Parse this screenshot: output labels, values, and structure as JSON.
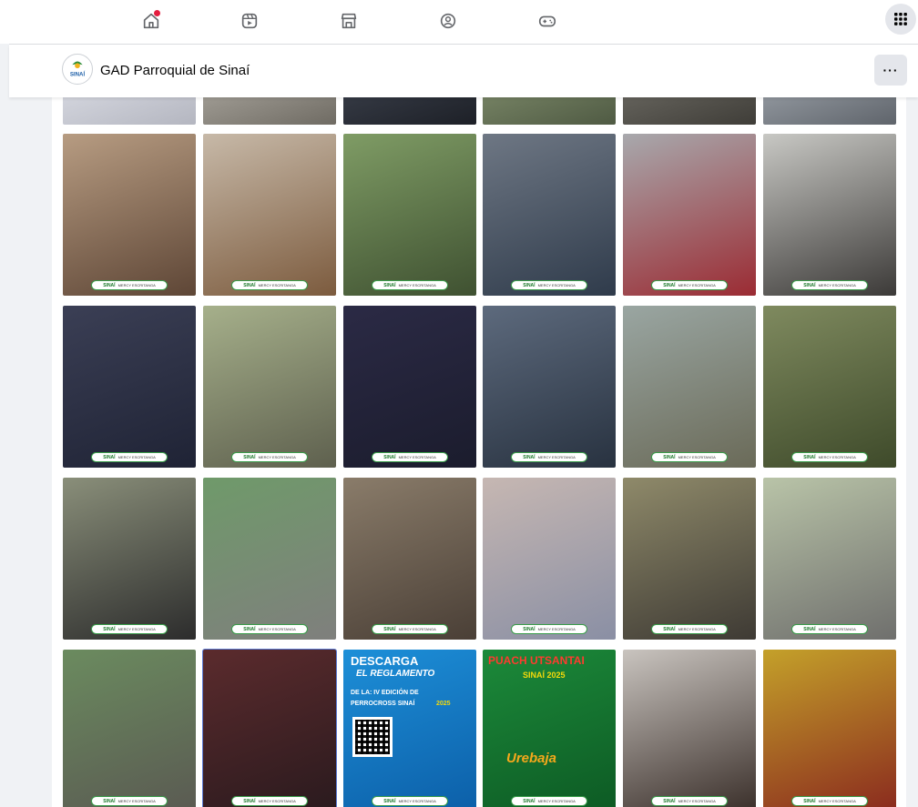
{
  "topnav": {
    "icons": [
      "home-icon",
      "video-icon",
      "marketplace-icon",
      "groups-icon",
      "gaming-icon",
      "menu-grid-icon"
    ],
    "home_has_notification": true
  },
  "page_header": {
    "avatar_text": "SINAÍ",
    "page_name": "GAD Parroquial de Sinaí",
    "more_label": "···"
  },
  "photos": {
    "badge": {
      "brand": "SINAÍ",
      "text": "MERCY ESCRITANGA"
    },
    "rows": [
      {
        "tiles": [
          {
            "colors": [
              "#d9dbe3",
              "#b4b6c0"
            ]
          },
          {
            "colors": [
              "#a9a59d",
              "#6f6b63"
            ]
          },
          {
            "colors": [
              "#3a3f4a",
              "#1d2027"
            ]
          },
          {
            "colors": [
              "#7d8a6a",
              "#4f5a43"
            ]
          },
          {
            "colors": [
              "#6c6a63",
              "#3f3d38"
            ]
          },
          {
            "colors": [
              "#9aa0a7",
              "#5f646b"
            ]
          }
        ]
      },
      {
        "tiles": [
          {
            "colors": [
              "#b79c82",
              "#5e4636"
            ]
          },
          {
            "colors": [
              "#c7b9a8",
              "#7c5b3e"
            ]
          },
          {
            "colors": [
              "#7f9c65",
              "#3f5131"
            ]
          },
          {
            "colors": [
              "#6e7784",
              "#2f3b4b"
            ]
          },
          {
            "colors": [
              "#a8a9ad",
              "#9b2b33"
            ]
          },
          {
            "colors": [
              "#c8c8c4",
              "#3c3a38"
            ]
          }
        ]
      },
      {
        "tiles": [
          {
            "colors": [
              "#3b3f55",
              "#1f2335"
            ]
          },
          {
            "colors": [
              "#a6b08b",
              "#5e604e"
            ]
          },
          {
            "colors": [
              "#2b2a45",
              "#1b1c2d"
            ]
          },
          {
            "colors": [
              "#5d6a7d",
              "#283240"
            ]
          },
          {
            "colors": [
              "#9aa6a2",
              "#6a6a58"
            ]
          },
          {
            "colors": [
              "#7f8a5f",
              "#3e4a2a"
            ]
          }
        ]
      },
      {
        "tiles": [
          {
            "colors": [
              "#8a8f7a",
              "#2c2c2c"
            ]
          },
          {
            "colors": [
              "#6f9a6a",
              "#7f7f7d"
            ]
          },
          {
            "colors": [
              "#8a7c6a",
              "#4a3f36"
            ]
          },
          {
            "colors": [
              "#c6b7b2",
              "#8a8fa4"
            ]
          },
          {
            "colors": [
              "#8f8a6a",
              "#3e3a34"
            ]
          },
          {
            "colors": [
              "#b9c4a8",
              "#6f6f6d"
            ]
          }
        ]
      },
      {
        "tiles": [
          {
            "colors": [
              "#6b8b5f",
              "#5a5a52"
            ]
          },
          {
            "colors": [
              "#5b2b2d",
              "#2a1a1e"
            ],
            "selected": true
          },
          {
            "colors": [
              "#1d8fd8",
              "#0c5fa8"
            ],
            "title": "DESCARGA",
            "subtitle": "EL REGLAMENTO",
            "line1": "DE LA: IV EDICIÓN DE",
            "line2": "PERROCROSS SINAÍ",
            "year": "2025"
          },
          {
            "colors": [
              "#1c8a3a",
              "#0d5a24"
            ],
            "title": "PUACH UTSANTAI",
            "subtitle": "SINAÍ 2025",
            "event": "Urebaja"
          },
          {
            "colors": [
              "#c9c4bf",
              "#3a2f2a"
            ]
          },
          {
            "colors": [
              "#c4a12a",
              "#8a2a1e"
            ]
          }
        ]
      }
    ]
  }
}
